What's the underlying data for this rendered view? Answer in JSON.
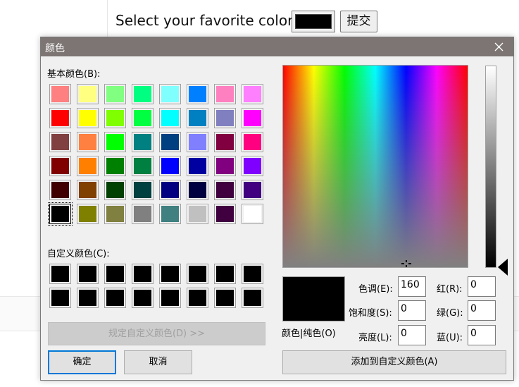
{
  "page": {
    "label": "Select your favorite color:",
    "swatch_color": "#000000",
    "submit_label": "提交"
  },
  "dialog": {
    "title": "颜色",
    "basic_colors_label": "基本颜色(B):",
    "basic_colors": [
      "#ff8080",
      "#ffff80",
      "#80ff80",
      "#00ff80",
      "#80ffff",
      "#0080ff",
      "#ff80c0",
      "#ff80ff",
      "#ff0000",
      "#ffff00",
      "#80ff00",
      "#00ff40",
      "#00ffff",
      "#0080c0",
      "#8080c0",
      "#ff00ff",
      "#804040",
      "#ff8040",
      "#00ff00",
      "#008080",
      "#004080",
      "#8080ff",
      "#800040",
      "#ff0080",
      "#800000",
      "#ff8000",
      "#008000",
      "#008040",
      "#0000ff",
      "#0000a0",
      "#800080",
      "#8000ff",
      "#400000",
      "#804000",
      "#004000",
      "#004040",
      "#000080",
      "#000040",
      "#400040",
      "#400080",
      "#000000",
      "#808000",
      "#808040",
      "#808080",
      "#408080",
      "#c0c0c0",
      "#400040",
      "#ffffff"
    ],
    "selected_basic_index": 40,
    "custom_colors_label": "自定义颜色(C):",
    "custom_colors": [
      "#000000",
      "#000000",
      "#000000",
      "#000000",
      "#000000",
      "#000000",
      "#000000",
      "#000000",
      "#000000",
      "#000000",
      "#000000",
      "#000000",
      "#000000",
      "#000000",
      "#000000",
      "#000000"
    ],
    "define_custom_label": "规定自定义颜色(D) >>",
    "ok_label": "确定",
    "cancel_label": "取消",
    "color_solid_label": "颜色|纯色(O)",
    "hue_label": "色调(E):",
    "hue_value": "160",
    "sat_label": "饱和度(S):",
    "sat_value": "0",
    "lum_label": "亮度(L):",
    "lum_value": "0",
    "red_label": "红(R):",
    "red_value": "0",
    "green_label": "绿(G):",
    "green_value": "0",
    "blue_label": "蓝(U):",
    "blue_value": "0",
    "add_custom_label": "添加到自定义颜色(A)",
    "preview_color": "#000000",
    "hue": 160,
    "saturation": 0,
    "luminance": 0
  }
}
